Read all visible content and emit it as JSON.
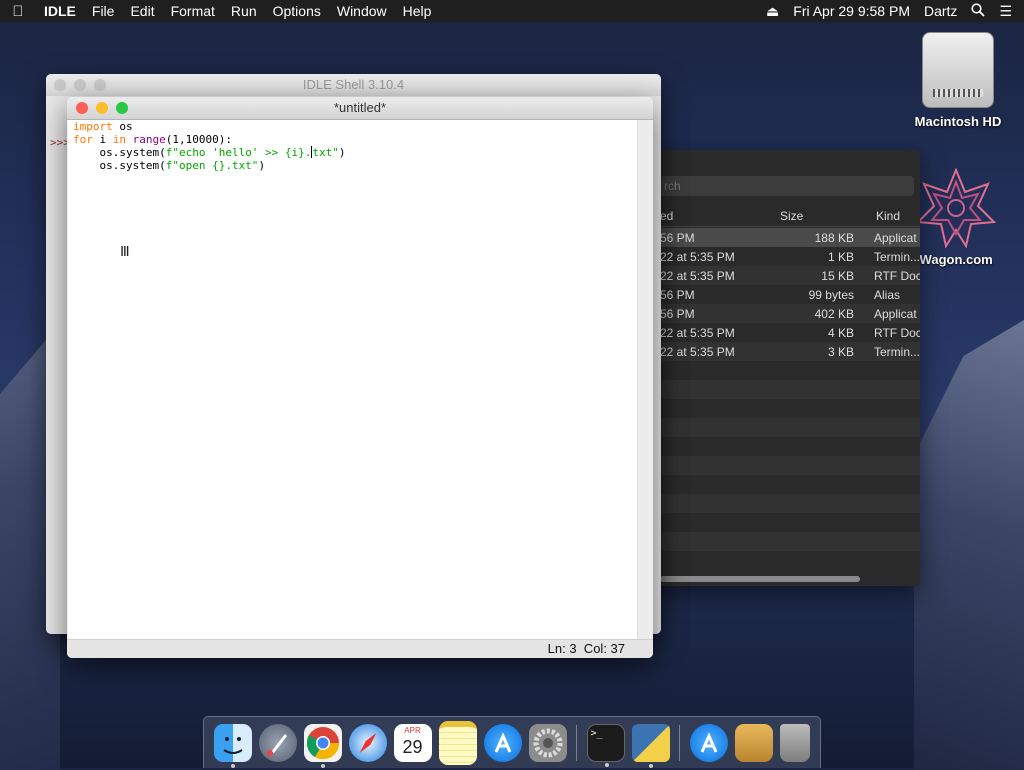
{
  "menubar": {
    "apple_icon": "apple-icon",
    "app_name": "IDLE",
    "menus": [
      "File",
      "Edit",
      "Format",
      "Run",
      "Options",
      "Window",
      "Help"
    ],
    "eject_icon": "eject-icon",
    "datetime": "Fri Apr 29  9:58 PM",
    "user": "Dartz",
    "search_icon": "search-icon",
    "list_icon": "list-icon"
  },
  "desktop": {
    "hd_label": "Macintosh HD",
    "datawagon_label": "taWagon.com"
  },
  "finder": {
    "search_placeholder": "rch",
    "columns": {
      "modified": "ed",
      "size": "Size",
      "kind": "Kind"
    },
    "rows": [
      {
        "modified": "56 PM",
        "size": "188 KB",
        "kind": "Applicat"
      },
      {
        "modified": "22 at 5:35 PM",
        "size": "1 KB",
        "kind": "Termin..."
      },
      {
        "modified": "22 at 5:35 PM",
        "size": "15 KB",
        "kind": "RTF Doc"
      },
      {
        "modified": "56 PM",
        "size": "99 bytes",
        "kind": "Alias"
      },
      {
        "modified": "56 PM",
        "size": "402 KB",
        "kind": "Applicat"
      },
      {
        "modified": "22 at 5:35 PM",
        "size": "4 KB",
        "kind": "RTF Doc"
      },
      {
        "modified": "22 at 5:35 PM",
        "size": "3 KB",
        "kind": "Termin..."
      }
    ]
  },
  "shell": {
    "title": "IDLE Shell 3.10.4",
    "prompt": ">>>"
  },
  "editor": {
    "title": "*untitled*",
    "status": "Ln: 3  Col: 37"
  },
  "dock": {
    "items": [
      "finder-icon",
      "launchpad-icon",
      "chrome-icon",
      "safari-icon",
      "calendar-icon",
      "notes-icon",
      "app-store-icon",
      "system-preferences-icon",
      "terminal-icon",
      "python-launcher-icon",
      "app-store-2-icon",
      "installer-icon",
      "trash-icon"
    ],
    "calendar_month": "APR",
    "calendar_day": "29",
    "terminal_prompt": ">_"
  },
  "colors": {
    "keyword": "#ff7700",
    "builtin": "#900090",
    "string": "#00aa00"
  }
}
